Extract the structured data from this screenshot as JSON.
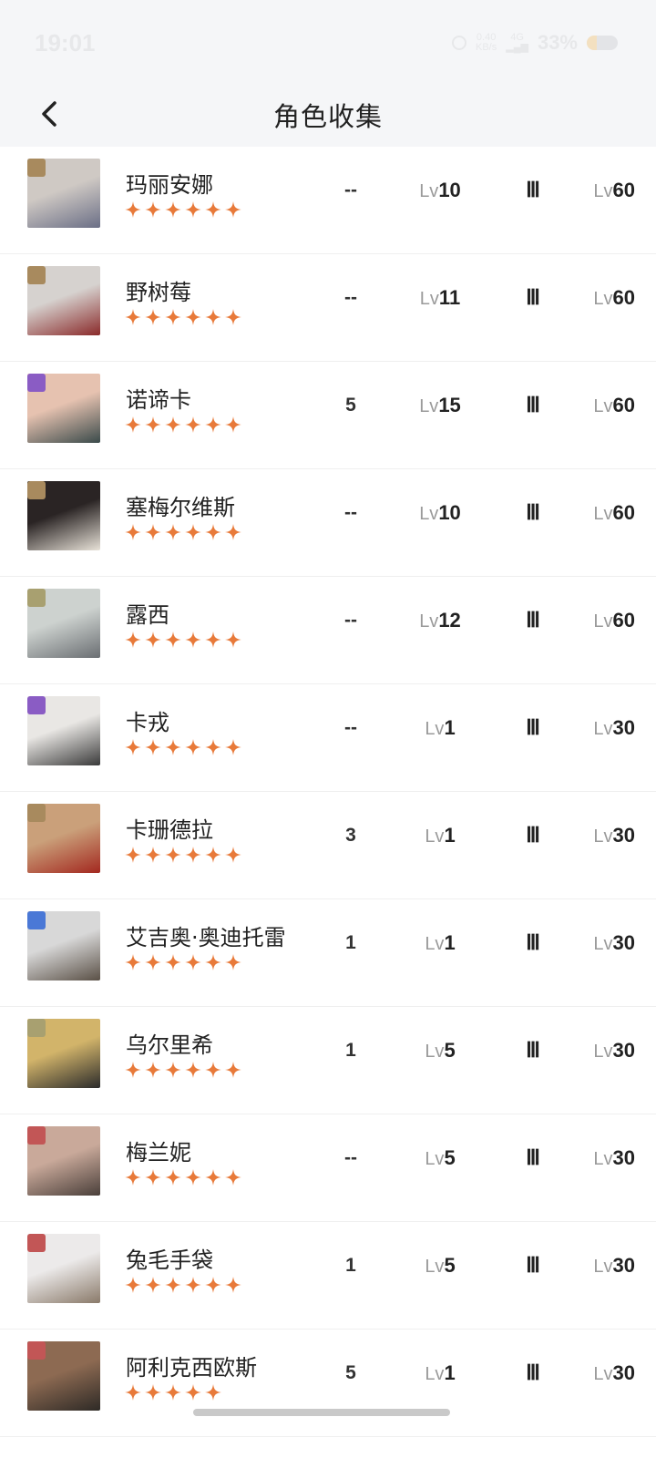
{
  "status_bar": {
    "time": "19:01",
    "speed_value": "0.40",
    "speed_unit": "KB/s",
    "network_label": "4G",
    "battery_percent_text": "33%",
    "battery_level": 0.33
  },
  "header": {
    "title": "角色收集"
  },
  "colors": {
    "star": "#e87a3a",
    "element_tan": "#a88a5e",
    "element_purple": "#8a5cc4",
    "element_olive": "#a8a070",
    "element_blue": "#4a78d6",
    "element_red": "#c25656"
  },
  "characters": [
    {
      "name": "玛丽安娜",
      "element_icon": "tan",
      "stars": 6,
      "col_a": "--",
      "lv_prefix": "Lv",
      "level": "10",
      "tier": "Ⅲ",
      "max_prefix": "Lv",
      "max_level": "60"
    },
    {
      "name": "野树莓",
      "element_icon": "tan",
      "stars": 6,
      "col_a": "--",
      "lv_prefix": "Lv",
      "level": "11",
      "tier": "Ⅲ",
      "max_prefix": "Lv",
      "max_level": "60"
    },
    {
      "name": "诺谛卡",
      "element_icon": "purple",
      "stars": 6,
      "col_a": "5",
      "lv_prefix": "Lv",
      "level": "15",
      "tier": "Ⅲ",
      "max_prefix": "Lv",
      "max_level": "60"
    },
    {
      "name": "塞梅尔维斯",
      "element_icon": "tan",
      "stars": 6,
      "col_a": "--",
      "lv_prefix": "Lv",
      "level": "10",
      "tier": "Ⅲ",
      "max_prefix": "Lv",
      "max_level": "60"
    },
    {
      "name": "露西",
      "element_icon": "olive",
      "stars": 6,
      "col_a": "--",
      "lv_prefix": "Lv",
      "level": "12",
      "tier": "Ⅲ",
      "max_prefix": "Lv",
      "max_level": "60"
    },
    {
      "name": "卡戎",
      "element_icon": "purple",
      "stars": 6,
      "col_a": "--",
      "lv_prefix": "Lv",
      "level": "1",
      "tier": "Ⅲ",
      "max_prefix": "Lv",
      "max_level": "30"
    },
    {
      "name": "卡珊德拉",
      "element_icon": "tan",
      "stars": 6,
      "col_a": "3",
      "lv_prefix": "Lv",
      "level": "1",
      "tier": "Ⅲ",
      "max_prefix": "Lv",
      "max_level": "30"
    },
    {
      "name": "艾吉奥·奥迪托雷",
      "element_icon": "blue",
      "stars": 6,
      "col_a": "1",
      "lv_prefix": "Lv",
      "level": "1",
      "tier": "Ⅲ",
      "max_prefix": "Lv",
      "max_level": "30"
    },
    {
      "name": "乌尔里希",
      "element_icon": "olive",
      "stars": 6,
      "col_a": "1",
      "lv_prefix": "Lv",
      "level": "5",
      "tier": "Ⅲ",
      "max_prefix": "Lv",
      "max_level": "30"
    },
    {
      "name": "梅兰妮",
      "element_icon": "red",
      "stars": 6,
      "col_a": "--",
      "lv_prefix": "Lv",
      "level": "5",
      "tier": "Ⅲ",
      "max_prefix": "Lv",
      "max_level": "30"
    },
    {
      "name": "兔毛手袋",
      "element_icon": "red",
      "stars": 6,
      "col_a": "1",
      "lv_prefix": "Lv",
      "level": "5",
      "tier": "Ⅲ",
      "max_prefix": "Lv",
      "max_level": "30"
    },
    {
      "name": "阿利克西欧斯",
      "element_icon": "red",
      "stars": 5,
      "col_a": "5",
      "lv_prefix": "Lv",
      "level": "1",
      "tier": "Ⅲ",
      "max_prefix": "Lv",
      "max_level": "30"
    }
  ]
}
